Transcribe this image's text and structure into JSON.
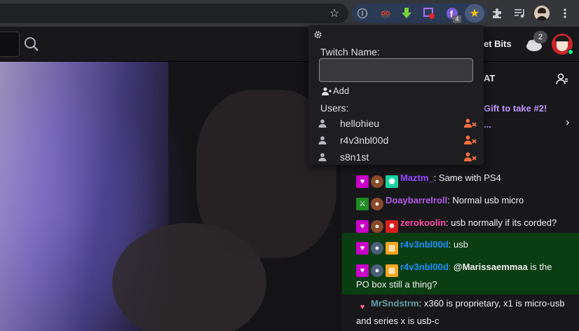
{
  "browser": {
    "toolbar_icons": [
      "star-icon",
      "info-icon",
      "owl-extension-icon",
      "download-arrow-icon",
      "twitch-extension-icon",
      "f-extension-icon",
      "star-extension-icon",
      "puzzle-icon",
      "media-queue-icon",
      "profile-avatar",
      "kebab-menu-icon"
    ],
    "f_extension_badge": "4"
  },
  "twitch": {
    "get_bits_label": "et Bits",
    "notifications_count": "2",
    "chat_header_partial": "AT",
    "pinned_partial": "Gift to take #2!",
    "pinned_more": "..."
  },
  "popup": {
    "twitch_name_label": "Twitch Name:",
    "name_input_value": "",
    "add_label": "Add",
    "users_label": "Users:",
    "users": [
      "hellohieu",
      "r4v3nbl00d",
      "s8n1st"
    ]
  },
  "chat": [
    {
      "user": "Maztm_",
      "user_color": "#9147ff",
      "text": ": Same with PS4"
    },
    {
      "user": "Doaybarrelroll",
      "user_color": "#b05ae8",
      "text": ": Normal usb micro"
    },
    {
      "user": "zerokoolin",
      "user_color": "#ff4aa8",
      "text": ": usb normally if its corded?"
    },
    {
      "user": "r4v3nbl00d",
      "user_color": "#1e90ff",
      "text": ": usb"
    },
    {
      "user": "r4v3nbl00d",
      "user_color": "#1e90ff",
      "text_mention": "@Marissaemmaa",
      "text_tail": " is the PO box still a thing?"
    },
    {
      "user": "MrSndstrm",
      "user_color": "#5f9ea0",
      "text": ": x360 is proprietary, x1 is micro-usb and series x is usb-c"
    }
  ],
  "colors": {
    "highlight_bg": "#0b3d12",
    "popup_bg": "#1e1e21",
    "chrome_toolbar": "#35363a",
    "sub_badge": "#c800c8",
    "remove_icon": "#ff6f3c"
  }
}
